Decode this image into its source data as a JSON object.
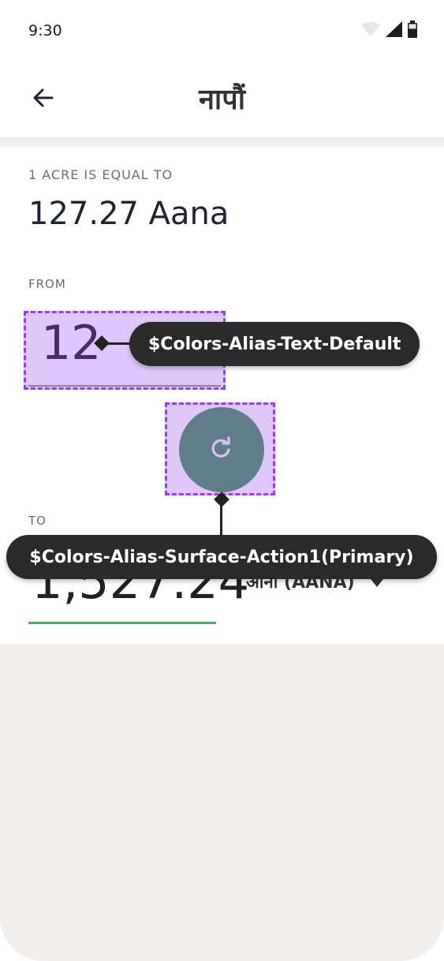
{
  "status": {
    "time": "9:30",
    "icons": [
      "wifi-icon",
      "signal-icon",
      "battery-icon"
    ]
  },
  "appbar": {
    "title": "नापौं",
    "back_icon": "arrow-left-icon"
  },
  "equal": {
    "label": "1 ACRE IS EQUAL TO",
    "value": "127.27 Aana"
  },
  "from": {
    "label": "FROM",
    "value": "12"
  },
  "swap": {
    "icon": "refresh-icon",
    "color": "#5e7f89"
  },
  "to": {
    "label": "TO",
    "value": "1,527.24",
    "unit": "आना (AANA)",
    "unit_icon": "caret-down-icon"
  },
  "annotations": {
    "text_default": "$Colors-Alias-Text-Default",
    "surface_action": "$Colors-Alias-Surface-Action1(Primary)"
  },
  "colors": {
    "highlight": "#dfc7fb",
    "highlight_border": "#9b3cf1",
    "tooltip_bg": "#2a2a2a",
    "to_underline": "#5ba26d"
  }
}
